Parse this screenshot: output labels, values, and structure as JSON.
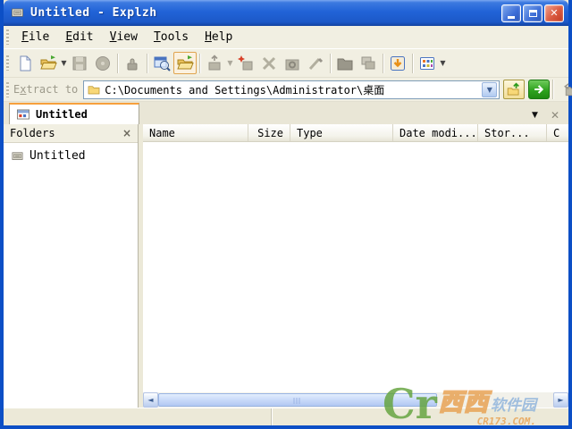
{
  "window": {
    "title": "Untitled - Explzh",
    "controls": [
      "minimize",
      "maximize",
      "close"
    ]
  },
  "menu_bar": {
    "items": [
      "File",
      "Edit",
      "View",
      "Tools",
      "Help"
    ]
  },
  "toolbar": {
    "icons": [
      "new-file",
      "open-folder",
      "save",
      "disc",
      "stamp",
      "preview",
      "explorer-folder",
      "add-to-archive",
      "new-archive",
      "delete",
      "repair-archive",
      "test-archive",
      "create-folder",
      "cascade-windows",
      "extract",
      "views"
    ]
  },
  "address_bar": {
    "label_prefix": "E",
    "label_underlined": "x",
    "label_suffix": "tract to",
    "path": "C:\\Documents and Settings\\Administrator\\桌面"
  },
  "tab_bar": {
    "tabs": [
      {
        "label": "Untitled",
        "active": true
      }
    ]
  },
  "folders_pane": {
    "title": "Folders",
    "close_glyph": "×",
    "items": [
      {
        "label": "Untitled"
      }
    ]
  },
  "file_list": {
    "columns": [
      "Name",
      "Size",
      "Type",
      "Date modi...",
      "Stor...",
      "C"
    ],
    "rows": []
  },
  "status_bar": {
    "sections": [
      "",
      ""
    ]
  },
  "watermark": {
    "logo_text": "Cr",
    "site_name_big": "西西",
    "site_name_small": "软件园",
    "site_url": "CR173.COM."
  },
  "colors": {
    "titlebar_blue": "#2163D7",
    "window_border": "#0C4FC6",
    "toolbar_bg": "#F1EFE2",
    "tab_active_accent": "#F7A03C",
    "go_button_green": "#2FA31F",
    "close_button_red": "#DA5A40",
    "combobox_border": "#7F9DB9"
  }
}
